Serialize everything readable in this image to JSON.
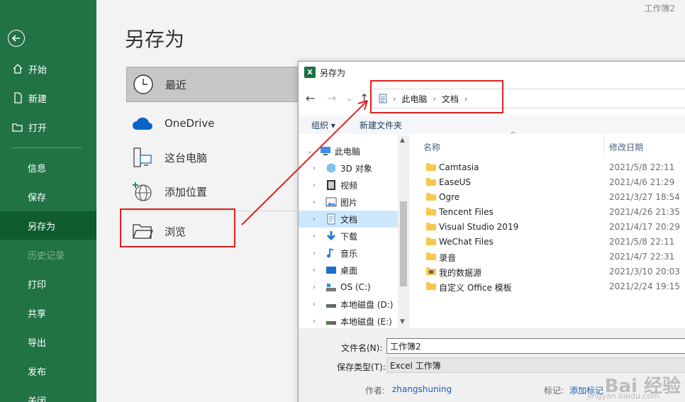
{
  "window": {
    "doc_name": "工作簿2"
  },
  "nav": {
    "items": [
      {
        "label": "开始",
        "icon": "home-icon"
      },
      {
        "label": "新建",
        "icon": "new-file-icon"
      },
      {
        "label": "打开",
        "icon": "open-folder-icon"
      },
      {
        "label": "信息"
      },
      {
        "label": "保存"
      },
      {
        "label": "另存为",
        "selected": true
      },
      {
        "label": "历史记录",
        "disabled": true
      },
      {
        "label": "打印"
      },
      {
        "label": "共享"
      },
      {
        "label": "导出"
      },
      {
        "label": "发布"
      },
      {
        "label": "关闭"
      }
    ]
  },
  "main": {
    "title": "另存为",
    "locations": [
      {
        "label": "最近",
        "icon": "clock-icon"
      },
      {
        "label": "OneDrive",
        "icon": "cloud-icon"
      },
      {
        "label": "这台电脑",
        "icon": "pc-icon"
      },
      {
        "label": "添加位置",
        "icon": "globe-add-icon"
      },
      {
        "label": "浏览",
        "icon": "folder-icon"
      }
    ]
  },
  "dialog": {
    "title": "另存为",
    "address": [
      "此电脑",
      "文档"
    ],
    "toolbar": {
      "organize": "组织 ▾",
      "new_folder": "新建文件夹"
    },
    "tree": [
      {
        "label": "此电脑",
        "expanded": true
      },
      {
        "label": "3D 对象"
      },
      {
        "label": "视频"
      },
      {
        "label": "图片"
      },
      {
        "label": "文档",
        "selected": true
      },
      {
        "label": "下载"
      },
      {
        "label": "音乐"
      },
      {
        "label": "桌面"
      },
      {
        "label": "OS (C:)"
      },
      {
        "label": "本地磁盘 (D:)"
      },
      {
        "label": "本地磁盘 (E:)"
      }
    ],
    "columns": {
      "name": "名称",
      "modified": "修改日期"
    },
    "files": [
      {
        "name": "Camtasia",
        "date": "2021/5/8 22:11"
      },
      {
        "name": "EaseUS",
        "date": "2021/4/6 21:29"
      },
      {
        "name": "Ogre",
        "date": "2021/3/27 18:54"
      },
      {
        "name": "Tencent Files",
        "date": "2021/4/26 21:35"
      },
      {
        "name": "Visual Studio 2019",
        "date": "2021/4/17 20:29"
      },
      {
        "name": "WeChat Files",
        "date": "2021/5/8 22:11"
      },
      {
        "name": "录音",
        "date": "2021/4/7 22:31"
      },
      {
        "name": "我的数据源",
        "date": "2021/3/10 20:03"
      },
      {
        "name": "自定义 Office 模板",
        "date": "2021/2/24 19:15"
      }
    ],
    "filename_label": "文件名(N):",
    "filename_value": "工作簿2",
    "filetype_label": "保存类型(T):",
    "filetype_value": "Excel 工作簿",
    "author_label": "作者:",
    "author_value": "zhangshuning",
    "tags_label": "标记:",
    "tags_value": "添加标记"
  },
  "watermark": {
    "brand": "Bai 经验",
    "url": "jingyan.baidu.com"
  },
  "colors": {
    "excel_green": "#217346",
    "selected_nav": "#0e5c2f",
    "highlight": "#e02020",
    "link": "#1a5fb4"
  }
}
